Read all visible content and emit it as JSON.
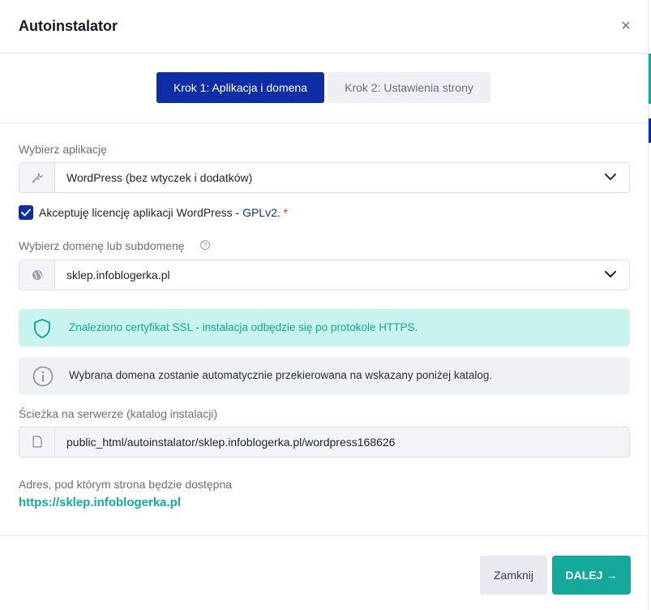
{
  "modal": {
    "title": "Autoinstalator",
    "close_symbol": "×"
  },
  "steps": [
    {
      "label": "Krok 1: Aplikacja i domena",
      "active": true
    },
    {
      "label": "Krok 2: Ustawienia strony",
      "active": false
    }
  ],
  "app_select": {
    "label": "Wybierz aplikację",
    "value": "WordPress (bez wtyczek i dodatków)",
    "icon": "wrench-icon"
  },
  "license": {
    "checked": true,
    "text": "Akceptuję licencję aplikacji WordPress - ",
    "link": "GPLv2.",
    "required_mark": "*"
  },
  "domain_select": {
    "label": "Wybierz domenę lub subdomenę",
    "help": "?",
    "value": "sklep.infoblogerka.pl",
    "icon": "globe-icon"
  },
  "ssl_alert": {
    "text": "Znaleziono certyfikat SSL - instalacja odbędzie się po protokole HTTPS.",
    "icon": "shield-icon",
    "color": "#16a896"
  },
  "info_alert": {
    "text": "Wybrana domena zostanie automatycznie przekierowana na wskazany poniżej katalog.",
    "icon": "info-icon"
  },
  "path": {
    "label": "Ścieżka na serwerze (katalog instalacji)",
    "value": "public_html/autoinstalator/sklep.infoblogerka.pl/wordpress168626",
    "icon": "file-icon"
  },
  "address": {
    "label": "Adres, pod którym strona będzie dostępna",
    "url": "https://sklep.infoblogerka.pl"
  },
  "footer": {
    "close_label": "Zamknij",
    "next_label": "DALEJ",
    "next_arrow": "→"
  },
  "colors": {
    "primary": "#0d2ea6",
    "accent": "#14a99a"
  }
}
